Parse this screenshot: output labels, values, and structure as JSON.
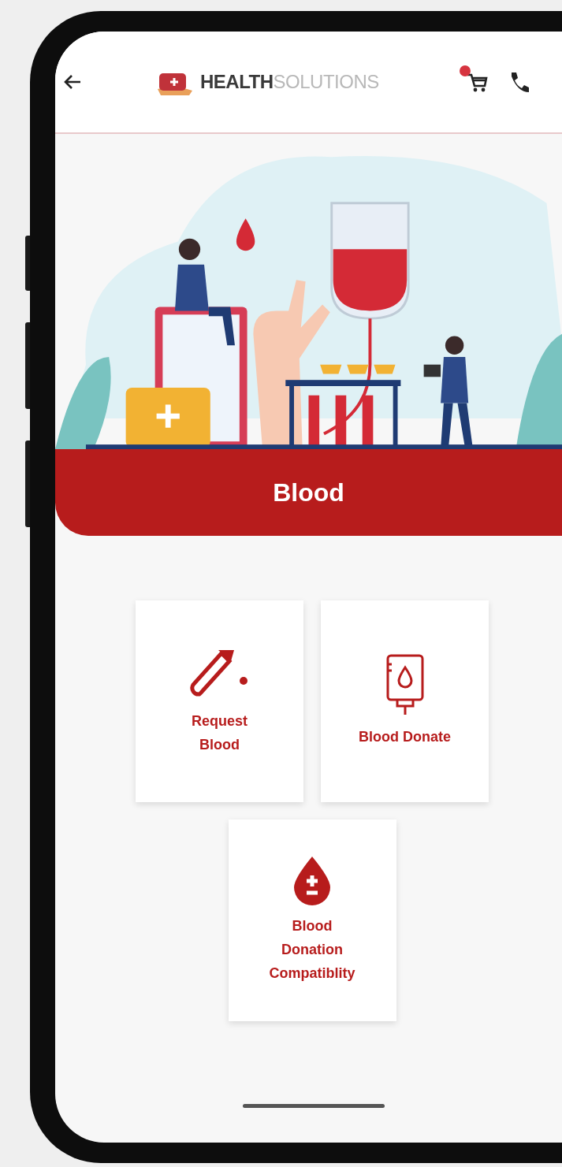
{
  "header": {
    "logo_text": "**HEALTH**SOLUTIONS",
    "cart": {
      "badge": true
    }
  },
  "banner": {
    "title": "Blood"
  },
  "tiles": [
    {
      "label": "Request Blood",
      "kind": "test-tube"
    },
    {
      "label": "Blood Donate",
      "kind": "blood-bag"
    },
    {
      "label": "Blood Donation Compatiblity",
      "kind": "blood-drop"
    }
  ]
}
